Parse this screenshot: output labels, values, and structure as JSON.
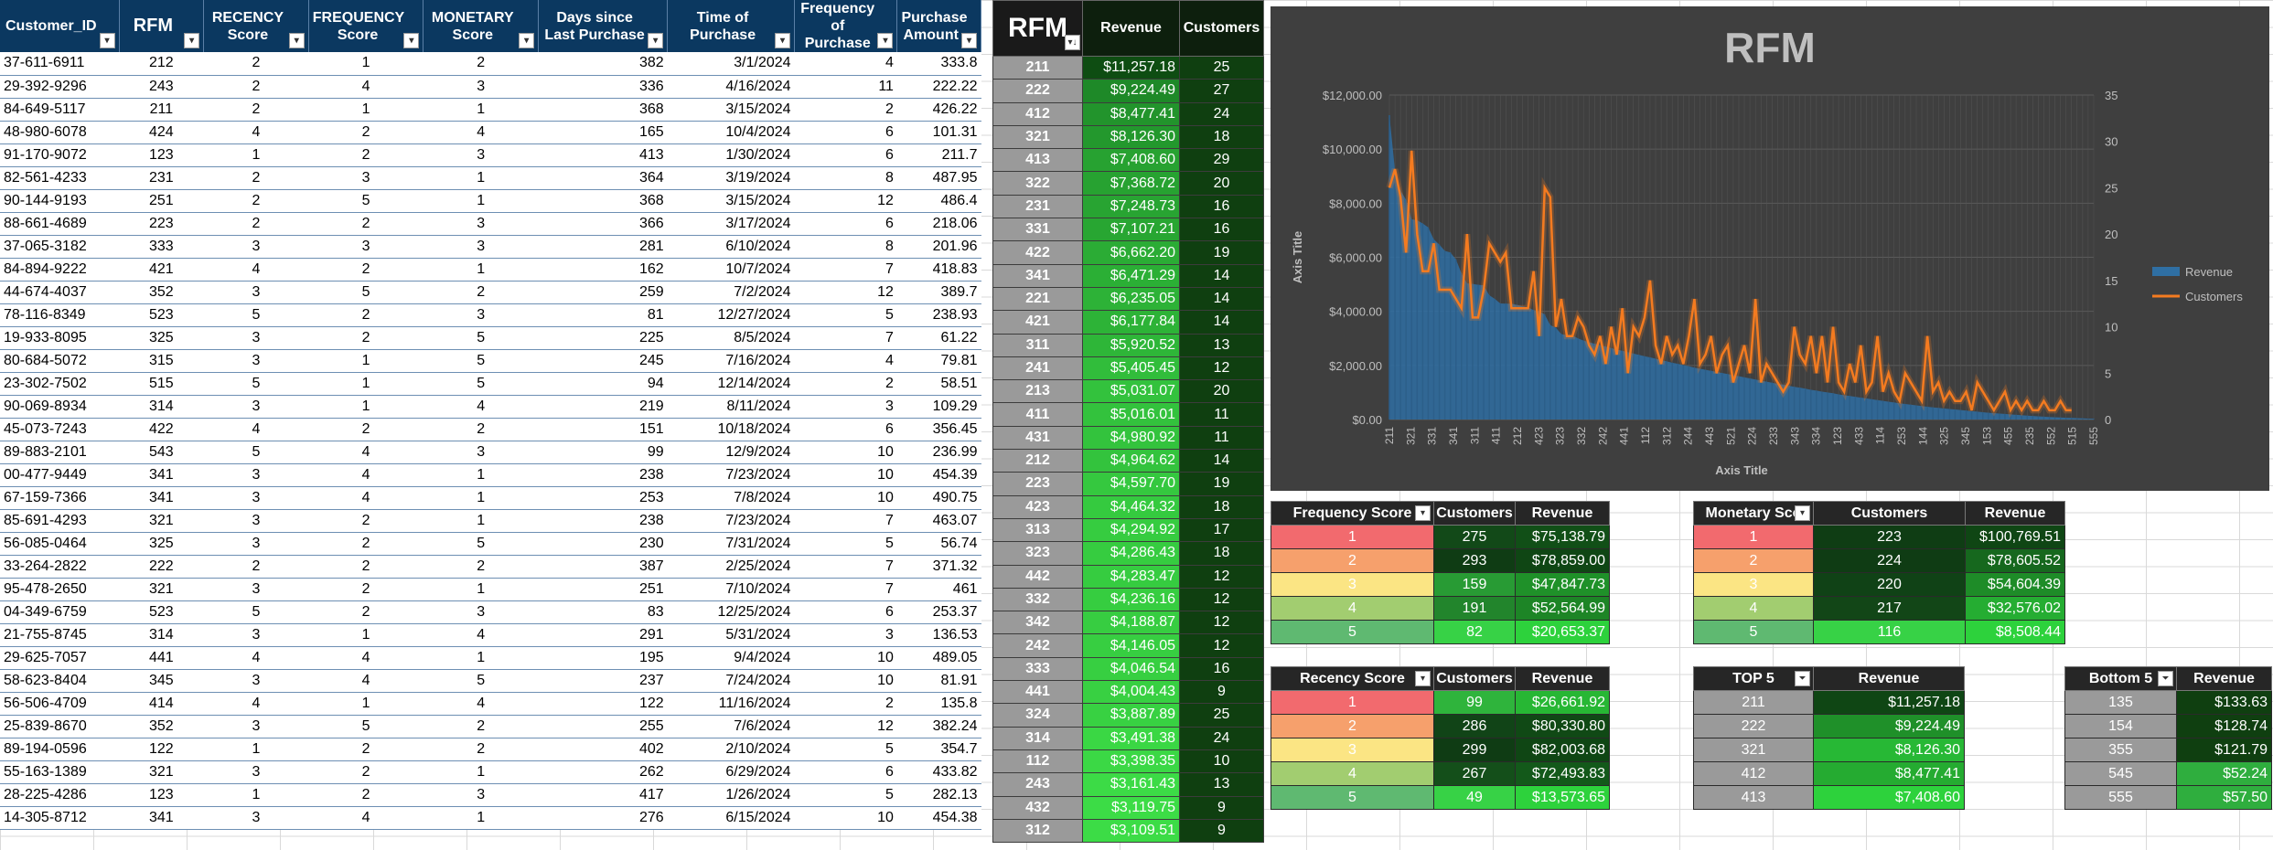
{
  "main_table": {
    "headers": [
      "Customer_ID",
      "RFM",
      "RECENCY Score",
      "FREQUENCY Score",
      "MONETARY Score",
      "Days since Last Purchase",
      "Time of Purchase",
      "Frequency of Purchase",
      "Purchase Amount"
    ],
    "rows": [
      [
        "37-611-6911",
        "212",
        "2",
        "1",
        "2",
        "382",
        "3/1/2024",
        "4",
        "333.8"
      ],
      [
        "29-392-9296",
        "243",
        "2",
        "4",
        "3",
        "336",
        "4/16/2024",
        "11",
        "222.22"
      ],
      [
        "84-649-5117",
        "211",
        "2",
        "1",
        "1",
        "368",
        "3/15/2024",
        "2",
        "426.22"
      ],
      [
        "48-980-6078",
        "424",
        "4",
        "2",
        "4",
        "165",
        "10/4/2024",
        "6",
        "101.31"
      ],
      [
        "91-170-9072",
        "123",
        "1",
        "2",
        "3",
        "413",
        "1/30/2024",
        "6",
        "211.7"
      ],
      [
        "82-561-4233",
        "231",
        "2",
        "3",
        "1",
        "364",
        "3/19/2024",
        "8",
        "487.95"
      ],
      [
        "90-144-9193",
        "251",
        "2",
        "5",
        "1",
        "368",
        "3/15/2024",
        "12",
        "486.4"
      ],
      [
        "88-661-4689",
        "223",
        "2",
        "2",
        "3",
        "366",
        "3/17/2024",
        "6",
        "218.06"
      ],
      [
        "37-065-3182",
        "333",
        "3",
        "3",
        "3",
        "281",
        "6/10/2024",
        "8",
        "201.96"
      ],
      [
        "84-894-9222",
        "421",
        "4",
        "2",
        "1",
        "162",
        "10/7/2024",
        "7",
        "418.83"
      ],
      [
        "44-674-4037",
        "352",
        "3",
        "5",
        "2",
        "259",
        "7/2/2024",
        "12",
        "389.7"
      ],
      [
        "78-116-8349",
        "523",
        "5",
        "2",
        "3",
        "81",
        "12/27/2024",
        "5",
        "238.93"
      ],
      [
        "19-933-8095",
        "325",
        "3",
        "2",
        "5",
        "225",
        "8/5/2024",
        "7",
        "61.22"
      ],
      [
        "80-684-5072",
        "315",
        "3",
        "1",
        "5",
        "245",
        "7/16/2024",
        "4",
        "79.81"
      ],
      [
        "23-302-7502",
        "515",
        "5",
        "1",
        "5",
        "94",
        "12/14/2024",
        "2",
        "58.51"
      ],
      [
        "90-069-8934",
        "314",
        "3",
        "1",
        "4",
        "219",
        "8/11/2024",
        "3",
        "109.29"
      ],
      [
        "45-073-7243",
        "422",
        "4",
        "2",
        "2",
        "151",
        "10/18/2024",
        "6",
        "356.45"
      ],
      [
        "89-883-2101",
        "543",
        "5",
        "4",
        "3",
        "99",
        "12/9/2024",
        "10",
        "236.99"
      ],
      [
        "00-477-9449",
        "341",
        "3",
        "4",
        "1",
        "238",
        "7/23/2024",
        "10",
        "454.39"
      ],
      [
        "67-159-7366",
        "341",
        "3",
        "4",
        "1",
        "253",
        "7/8/2024",
        "10",
        "490.75"
      ],
      [
        "85-691-4293",
        "321",
        "3",
        "2",
        "1",
        "238",
        "7/23/2024",
        "7",
        "463.07"
      ],
      [
        "56-085-0464",
        "325",
        "3",
        "2",
        "5",
        "230",
        "7/31/2024",
        "5",
        "56.74"
      ],
      [
        "33-264-2822",
        "222",
        "2",
        "2",
        "2",
        "387",
        "2/25/2024",
        "7",
        "371.32"
      ],
      [
        "95-478-2650",
        "321",
        "3",
        "2",
        "1",
        "251",
        "7/10/2024",
        "7",
        "461"
      ],
      [
        "04-349-6759",
        "523",
        "5",
        "2",
        "3",
        "83",
        "12/25/2024",
        "6",
        "253.37"
      ],
      [
        "21-755-8745",
        "314",
        "3",
        "1",
        "4",
        "291",
        "5/31/2024",
        "3",
        "136.53"
      ],
      [
        "29-625-7057",
        "441",
        "4",
        "4",
        "1",
        "195",
        "9/4/2024",
        "10",
        "489.05"
      ],
      [
        "58-623-8404",
        "345",
        "3",
        "4",
        "5",
        "237",
        "7/24/2024",
        "10",
        "81.91"
      ],
      [
        "56-506-4709",
        "414",
        "4",
        "1",
        "4",
        "122",
        "11/16/2024",
        "2",
        "135.8"
      ],
      [
        "25-839-8670",
        "352",
        "3",
        "5",
        "2",
        "255",
        "7/6/2024",
        "12",
        "382.24"
      ],
      [
        "89-194-0596",
        "122",
        "1",
        "2",
        "2",
        "402",
        "2/10/2024",
        "5",
        "354.7"
      ],
      [
        "55-163-1389",
        "321",
        "3",
        "2",
        "1",
        "262",
        "6/29/2024",
        "6",
        "433.82"
      ],
      [
        "28-225-4286",
        "123",
        "1",
        "2",
        "3",
        "417",
        "1/26/2024",
        "5",
        "282.13"
      ],
      [
        "14-305-8712",
        "341",
        "3",
        "4",
        "1",
        "276",
        "6/15/2024",
        "10",
        "454.38"
      ]
    ]
  },
  "rfm_table": {
    "headers": [
      "RFM",
      "Revenue",
      "Customers"
    ],
    "rows": [
      [
        "211",
        "$11,257.18",
        "25"
      ],
      [
        "222",
        "$9,224.49",
        "27"
      ],
      [
        "412",
        "$8,477.41",
        "24"
      ],
      [
        "321",
        "$8,126.30",
        "18"
      ],
      [
        "413",
        "$7,408.60",
        "29"
      ],
      [
        "322",
        "$7,368.72",
        "20"
      ],
      [
        "231",
        "$7,248.73",
        "16"
      ],
      [
        "331",
        "$7,107.21",
        "16"
      ],
      [
        "422",
        "$6,662.20",
        "19"
      ],
      [
        "341",
        "$6,471.29",
        "14"
      ],
      [
        "221",
        "$6,235.05",
        "14"
      ],
      [
        "421",
        "$6,177.84",
        "14"
      ],
      [
        "311",
        "$5,920.52",
        "13"
      ],
      [
        "241",
        "$5,405.45",
        "12"
      ],
      [
        "213",
        "$5,031.07",
        "20"
      ],
      [
        "411",
        "$5,016.01",
        "11"
      ],
      [
        "431",
        "$4,980.92",
        "11"
      ],
      [
        "212",
        "$4,964.62",
        "14"
      ],
      [
        "223",
        "$4,597.70",
        "19"
      ],
      [
        "423",
        "$4,464.32",
        "18"
      ],
      [
        "313",
        "$4,294.92",
        "17"
      ],
      [
        "323",
        "$4,286.43",
        "18"
      ],
      [
        "442",
        "$4,283.47",
        "12"
      ],
      [
        "332",
        "$4,236.16",
        "12"
      ],
      [
        "342",
        "$4,188.87",
        "12"
      ],
      [
        "242",
        "$4,146.05",
        "12"
      ],
      [
        "333",
        "$4,046.54",
        "16"
      ],
      [
        "441",
        "$4,004.43",
        "9"
      ],
      [
        "324",
        "$3,887.89",
        "25"
      ],
      [
        "314",
        "$3,491.38",
        "24"
      ],
      [
        "112",
        "$3,398.35",
        "10"
      ],
      [
        "243",
        "$3,161.43",
        "13"
      ],
      [
        "432",
        "$3,119.75",
        "9"
      ],
      [
        "312",
        "$3,109.51",
        "9"
      ]
    ]
  },
  "chart_data": {
    "type": "combo-area-line",
    "title": "RFM",
    "xlabel": "Axis Title",
    "ylabel": "Axis Title",
    "ylim_left": [
      0,
      12000
    ],
    "ylim_right": [
      0,
      35
    ],
    "y_ticks_left": [
      "$0.00",
      "$2,000.00",
      "$4,000.00",
      "$6,000.00",
      "$8,000.00",
      "$10,000.00",
      "$12,000.00"
    ],
    "y_ticks_right": [
      "0",
      "5",
      "10",
      "15",
      "20",
      "25",
      "30",
      "35"
    ],
    "x_tick_labels": [
      "211",
      "321",
      "331",
      "341",
      "311",
      "411",
      "212",
      "423",
      "323",
      "332",
      "242",
      "441",
      "112",
      "312",
      "244",
      "443",
      "521",
      "224",
      "233",
      "343",
      "334",
      "123",
      "433",
      "114",
      "253",
      "144",
      "325",
      "345",
      "153",
      "455",
      "235",
      "552",
      "515",
      "555"
    ],
    "legend": [
      "Revenue",
      "Customers"
    ],
    "legend_position": "right",
    "grid": true,
    "series": [
      {
        "name": "Revenue",
        "values": [
          11257,
          9224,
          8477,
          8126,
          7409,
          7369,
          7249,
          7107,
          6662,
          6471,
          6235,
          6178,
          5921,
          5405,
          5031,
          5016,
          4981,
          4965,
          4598,
          4464,
          4295,
          4286,
          4283,
          4236,
          4189,
          4146,
          4047,
          4004,
          3888,
          3491,
          3398,
          3161,
          3120,
          3110,
          3000,
          2920,
          2860,
          2800,
          2750,
          2700,
          2640,
          2590,
          2540,
          2490,
          2440,
          2390,
          2340,
          2300,
          2250,
          2200,
          2150,
          2100,
          2060,
          2010,
          1970,
          1920,
          1880,
          1840,
          1800,
          1760,
          1720,
          1680,
          1640,
          1600,
          1560,
          1520,
          1480,
          1440,
          1400,
          1360,
          1320,
          1290,
          1250,
          1210,
          1180,
          1140,
          1100,
          1070,
          1030,
          1000,
          970,
          930,
          900,
          870,
          840,
          810,
          780,
          750,
          720,
          690,
          660,
          630,
          600,
          575,
          550,
          525,
          500,
          475,
          450,
          430,
          410,
          390,
          370,
          350,
          330,
          310,
          290,
          270,
          250,
          235,
          220,
          205,
          190,
          175,
          160,
          145,
          130,
          118,
          106,
          95,
          85,
          75,
          65,
          58,
          50,
          42,
          35,
          28
        ]
      },
      {
        "name": "Customers",
        "values": [
          25,
          27,
          24,
          18,
          29,
          20,
          16,
          16,
          19,
          14,
          14,
          14,
          13,
          12,
          20,
          11,
          11,
          14,
          19,
          18,
          17,
          18,
          12,
          12,
          12,
          12,
          16,
          9,
          25,
          24,
          10,
          13,
          9,
          9,
          11,
          10,
          8,
          7,
          9,
          6,
          10,
          7,
          12,
          5,
          10,
          9,
          11,
          15,
          8,
          6,
          9,
          7,
          8,
          6,
          9,
          13,
          6,
          7,
          9,
          5,
          7,
          8,
          4,
          6,
          8,
          5,
          13,
          4,
          6,
          5,
          4,
          3,
          4,
          10,
          7,
          6,
          9,
          5,
          9,
          4,
          10,
          4,
          3,
          6,
          4,
          8,
          3,
          4,
          9,
          3,
          5,
          3,
          2,
          5,
          4,
          3,
          2,
          9,
          3,
          4,
          2,
          3,
          2,
          2,
          3,
          1,
          4,
          3,
          2,
          1,
          2,
          3,
          1,
          2,
          1,
          2,
          1,
          1,
          2,
          1,
          1,
          2,
          1,
          1
        ]
      }
    ]
  },
  "frequency_table": {
    "headers": [
      "Frequency Score",
      "Customers",
      "Revenue"
    ],
    "rows": [
      [
        "1",
        "275",
        "$75,138.79"
      ],
      [
        "2",
        "293",
        "$78,859.00"
      ],
      [
        "3",
        "159",
        "$47,847.73"
      ],
      [
        "4",
        "191",
        "$52,564.99"
      ],
      [
        "5",
        "82",
        "$20,653.37"
      ]
    ]
  },
  "monetary_table": {
    "headers": [
      "Monetary Sco",
      "Customers",
      "Revenue"
    ],
    "rows": [
      [
        "1",
        "223",
        "$100,769.51"
      ],
      [
        "2",
        "224",
        "$78,605.52"
      ],
      [
        "3",
        "220",
        "$54,604.39"
      ],
      [
        "4",
        "217",
        "$32,576.02"
      ],
      [
        "5",
        "116",
        "$8,508.44"
      ]
    ]
  },
  "recency_table": {
    "headers": [
      "Recency Score",
      "Customers",
      "Revenue"
    ],
    "rows": [
      [
        "1",
        "99",
        "$26,661.92"
      ],
      [
        "2",
        "286",
        "$80,330.80"
      ],
      [
        "3",
        "299",
        "$82,003.68"
      ],
      [
        "4",
        "267",
        "$72,493.83"
      ],
      [
        "5",
        "49",
        "$13,573.65"
      ]
    ]
  },
  "top5_table": {
    "headers": [
      "TOP 5",
      "Revenue"
    ],
    "rows": [
      [
        "211",
        "$11,257.18"
      ],
      [
        "222",
        "$9,224.49"
      ],
      [
        "321",
        "$8,126.30"
      ],
      [
        "412",
        "$8,477.41"
      ],
      [
        "413",
        "$7,408.60"
      ]
    ]
  },
  "bottom5_table": {
    "headers": [
      "Bottom 5",
      "Revenue"
    ],
    "rows": [
      [
        "135",
        "$133.63"
      ],
      [
        "154",
        "$128.74"
      ],
      [
        "355",
        "$121.79"
      ],
      [
        "545",
        "$52.24"
      ],
      [
        "555",
        "$57.50"
      ]
    ]
  },
  "colors": {
    "score_1": "#f26a6e",
    "score_2": "#f6a06c",
    "score_3": "#fbe584",
    "score_4": "#a2cd70",
    "score_5": "#5fb971",
    "revenue_line": "#f47b20",
    "revenue_area": "#2f6fa3"
  }
}
